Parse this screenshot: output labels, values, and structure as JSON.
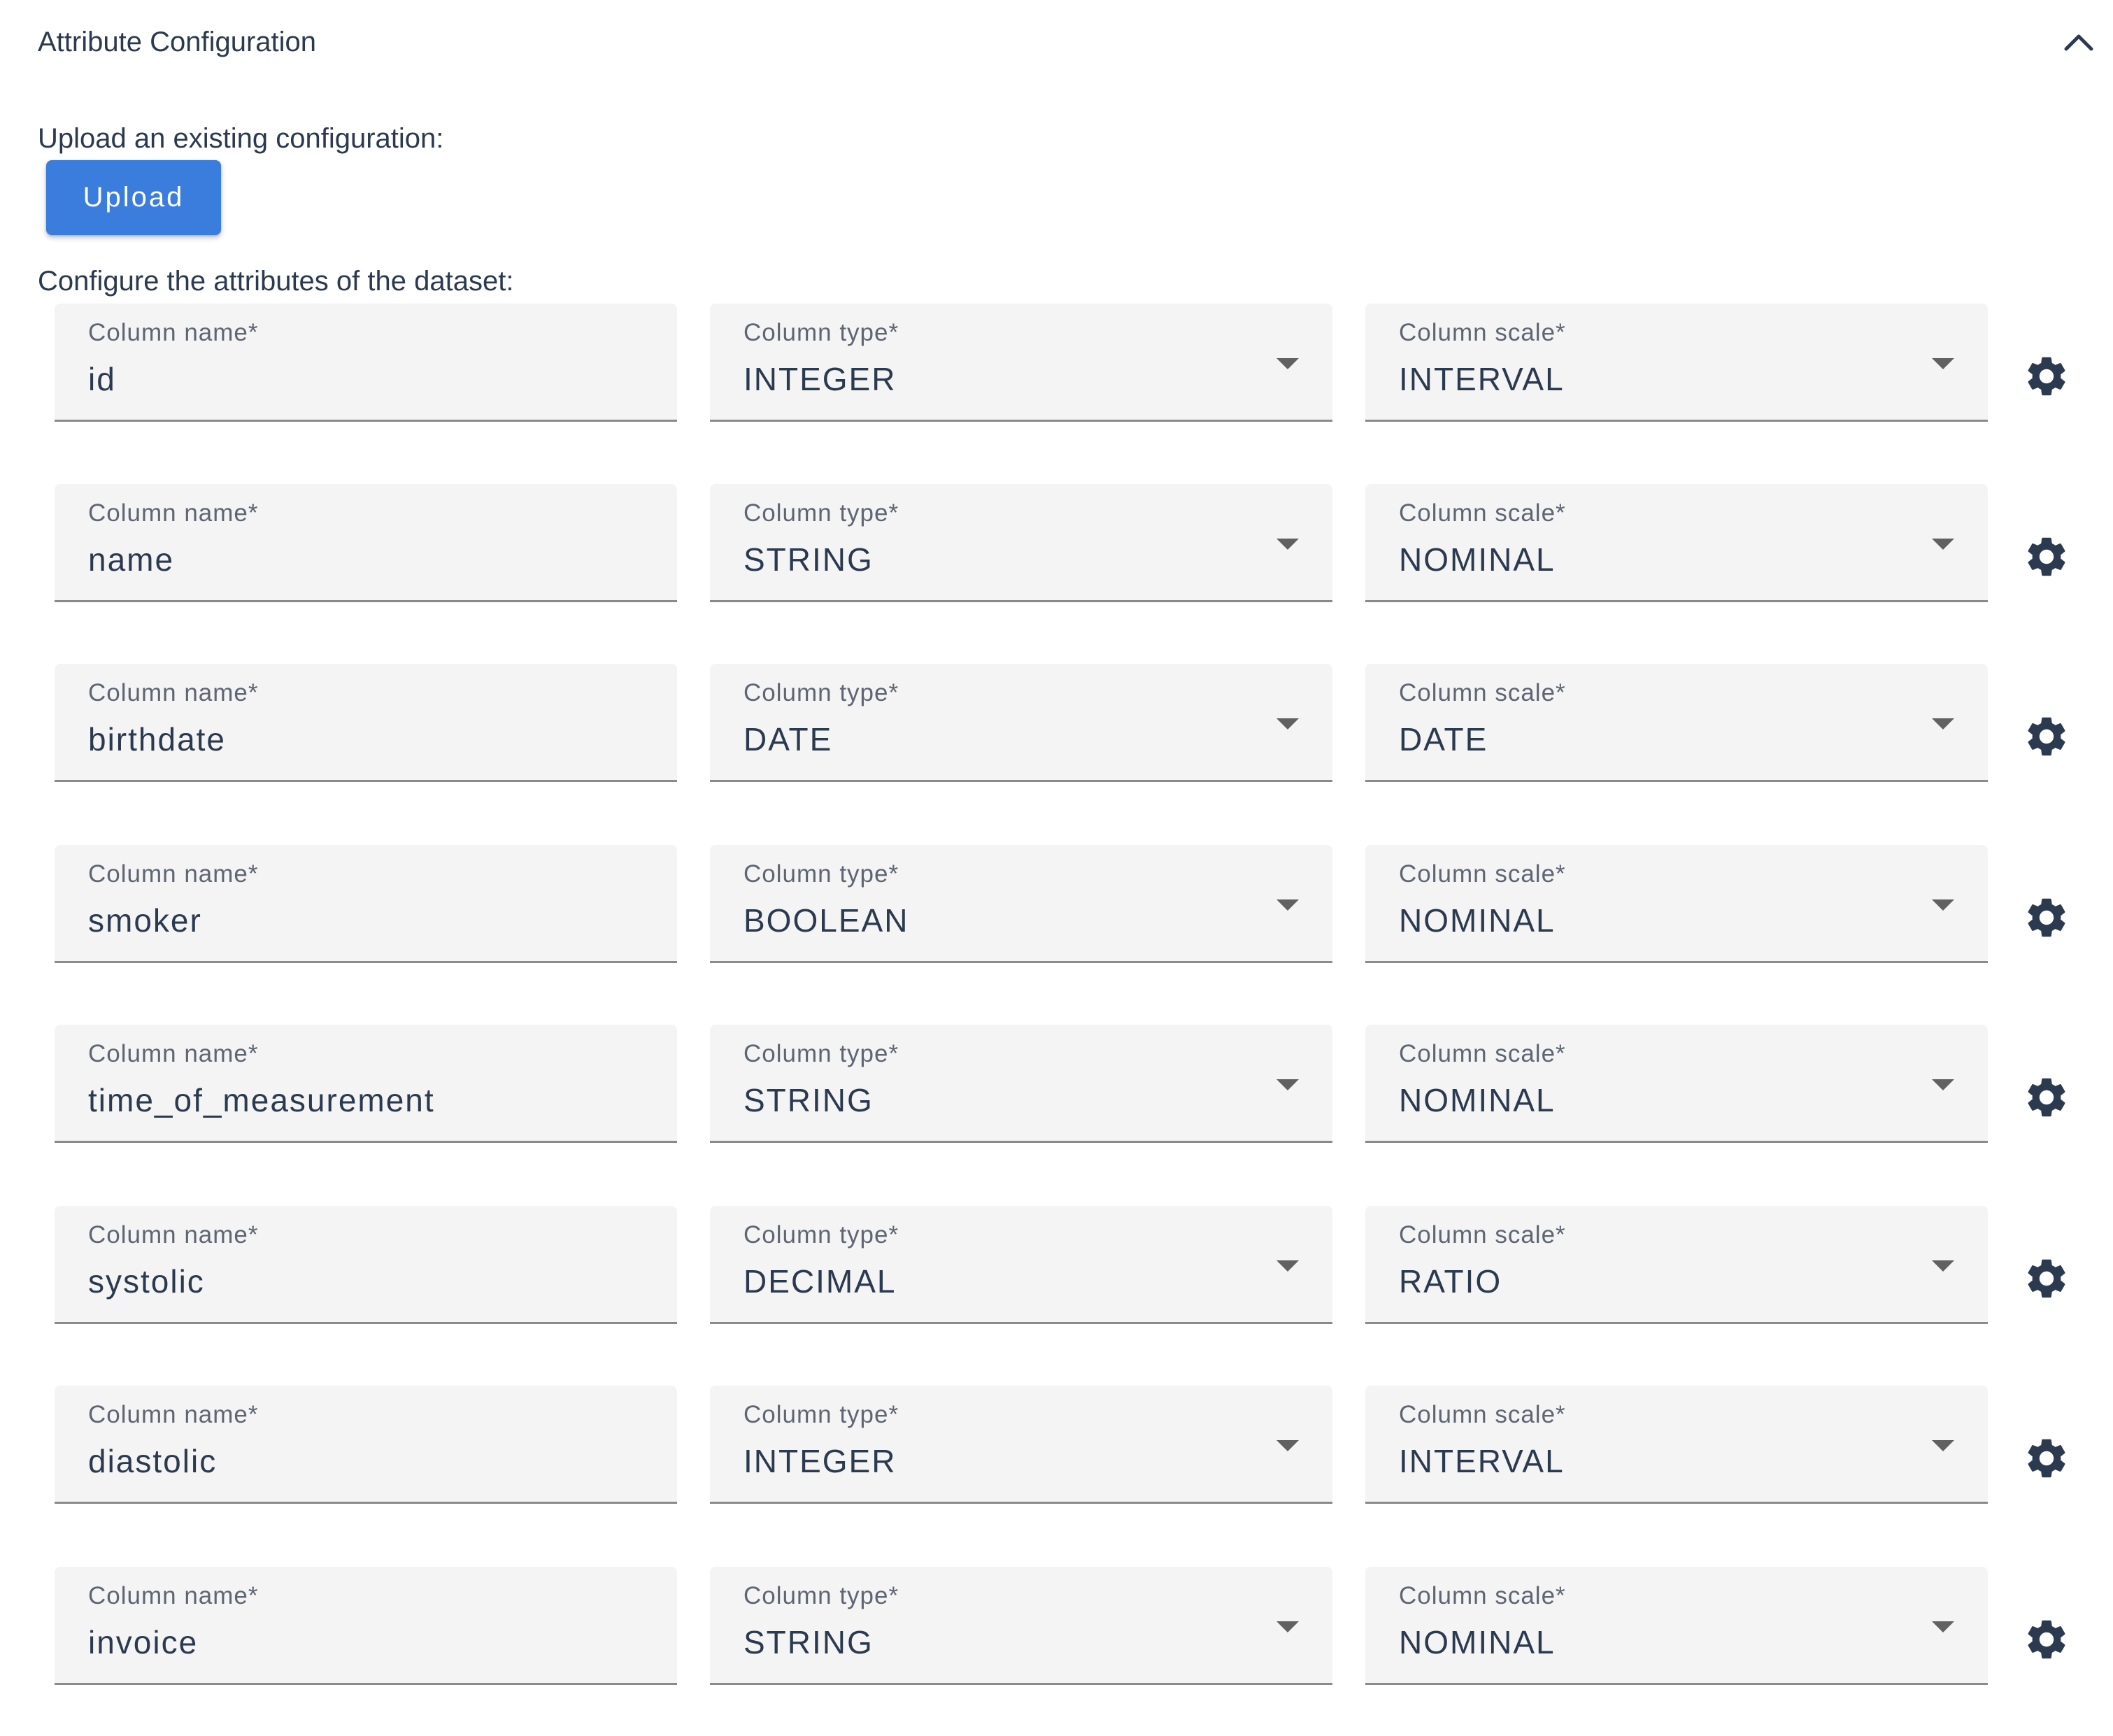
{
  "panel": {
    "title": "Attribute Configuration",
    "collapse_icon": "chevron-up-icon"
  },
  "upload": {
    "label": "Upload an existing configuration:",
    "button_label": "Upload"
  },
  "configure": {
    "label": "Configure the attributes of the dataset:"
  },
  "field_labels": {
    "name": "Column name*",
    "type": "Column type*",
    "scale": "Column scale*"
  },
  "attributes": [
    {
      "name": "id",
      "type": "INTEGER",
      "scale": "INTERVAL"
    },
    {
      "name": "name",
      "type": "STRING",
      "scale": "NOMINAL"
    },
    {
      "name": "birthdate",
      "type": "DATE",
      "scale": "DATE"
    },
    {
      "name": "smoker",
      "type": "BOOLEAN",
      "scale": "NOMINAL"
    },
    {
      "name": "time_of_measurement",
      "type": "STRING",
      "scale": "NOMINAL"
    },
    {
      "name": "systolic",
      "type": "DECIMAL",
      "scale": "RATIO"
    },
    {
      "name": "diastolic",
      "type": "INTEGER",
      "scale": "INTERVAL"
    },
    {
      "name": "invoice",
      "type": "STRING",
      "scale": "NOMINAL"
    }
  ],
  "icons": {
    "dropdown": "caret-down-icon",
    "settings": "gear-icon"
  },
  "colors": {
    "primary": "#3b7ddd",
    "text": "#2c3a4f",
    "field_bg": "#f4f4f4"
  }
}
